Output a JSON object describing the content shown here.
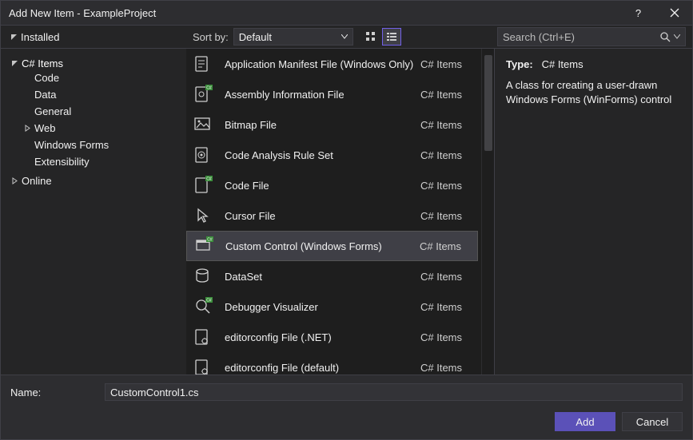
{
  "window": {
    "title": "Add New Item - ExampleProject"
  },
  "toolbar": {
    "installed_label": "Installed",
    "sort_by_label": "Sort by:",
    "sort_value": "Default",
    "search_placeholder": "Search (Ctrl+E)"
  },
  "tree": {
    "csharp_items": "C# Items",
    "children": [
      "Code",
      "Data",
      "General",
      "Web",
      "Windows Forms",
      "Extensibility"
    ],
    "online": "Online"
  },
  "templates": [
    {
      "label": "Application Manifest File (Windows Only)",
      "cat": "C# Items",
      "icon": "manifest"
    },
    {
      "label": "Assembly Information File",
      "cat": "C# Items",
      "icon": "assembly"
    },
    {
      "label": "Bitmap File",
      "cat": "C# Items",
      "icon": "bitmap"
    },
    {
      "label": "Code Analysis Rule Set",
      "cat": "C# Items",
      "icon": "ruleset"
    },
    {
      "label": "Code File",
      "cat": "C# Items",
      "icon": "codefile"
    },
    {
      "label": "Cursor File",
      "cat": "C# Items",
      "icon": "cursor"
    },
    {
      "label": "Custom Control (Windows Forms)",
      "cat": "C# Items",
      "icon": "customcontrol",
      "selected": true
    },
    {
      "label": "DataSet",
      "cat": "C# Items",
      "icon": "dataset"
    },
    {
      "label": "Debugger Visualizer",
      "cat": "C# Items",
      "icon": "visualizer"
    },
    {
      "label": "editorconfig File (.NET)",
      "cat": "C# Items",
      "icon": "editorconfig"
    },
    {
      "label": "editorconfig File (default)",
      "cat": "C# Items",
      "icon": "editorconfig"
    }
  ],
  "detail": {
    "type_label": "Type:",
    "type_value": "C# Items",
    "description": "A class for creating a user-drawn Windows Forms (WinForms) control"
  },
  "footer": {
    "name_label": "Name:",
    "name_value": "CustomControl1.cs",
    "add_label": "Add",
    "cancel_label": "Cancel"
  }
}
